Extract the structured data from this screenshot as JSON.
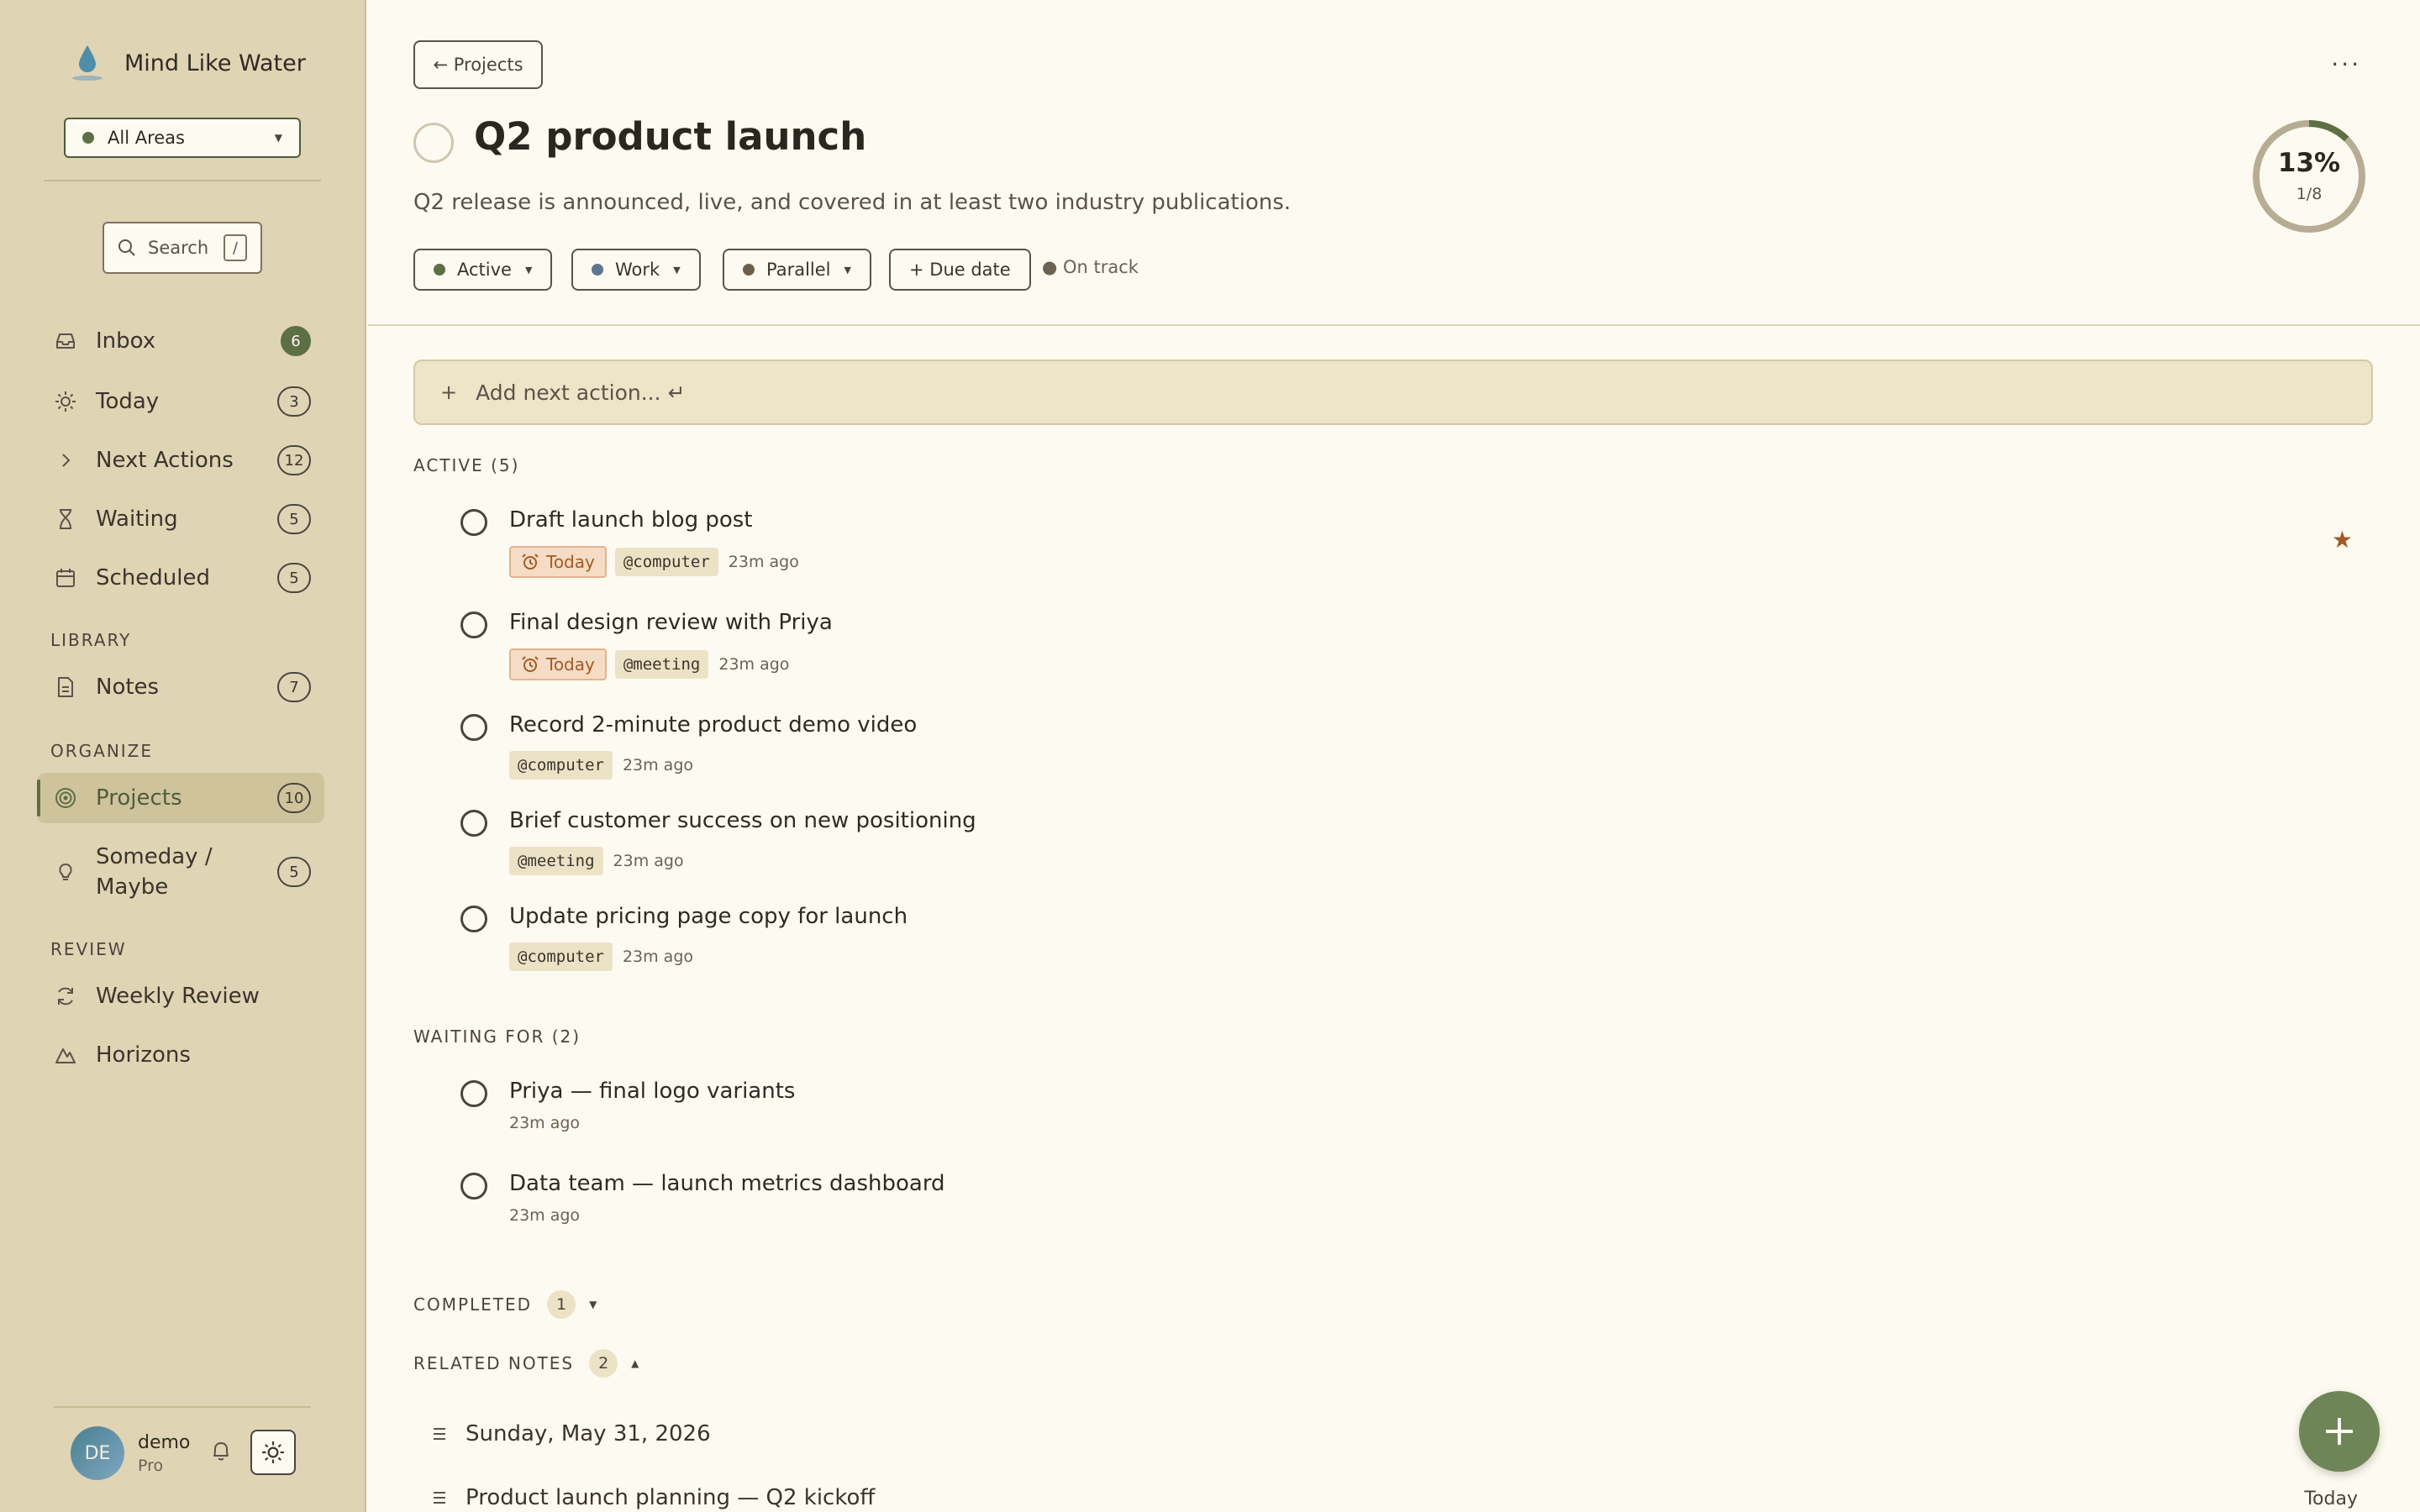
{
  "app": {
    "name": "Mind Like Water"
  },
  "area_selector": {
    "label": "All Areas"
  },
  "search": {
    "label": "Search",
    "shortcut": "/"
  },
  "nav": {
    "inbox": {
      "label": "Inbox",
      "count": "6"
    },
    "today": {
      "label": "Today",
      "count": "3"
    },
    "next_actions": {
      "label": "Next Actions",
      "count": "12"
    },
    "waiting": {
      "label": "Waiting",
      "count": "5"
    },
    "scheduled": {
      "label": "Scheduled",
      "count": "5"
    }
  },
  "library": {
    "label": "LIBRARY",
    "notes": {
      "label": "Notes",
      "count": "7"
    }
  },
  "organize": {
    "label": "ORGANIZE",
    "projects": {
      "label": "Projects",
      "count": "10"
    },
    "someday": {
      "label_line1": "Someday /",
      "label_line2": "Maybe",
      "count": "5"
    }
  },
  "review": {
    "label": "REVIEW",
    "weekly": {
      "label": "Weekly Review"
    },
    "horizons": {
      "label": "Horizons"
    }
  },
  "user": {
    "initials": "DE",
    "name": "demo",
    "plan": "Pro"
  },
  "project": {
    "back_label": "← Projects",
    "more_label": "···",
    "title": "Q2 product launch",
    "description": "Q2 release is announced, live, and covered in at least two industry publications.",
    "status_chip": "Active",
    "area_chip": "Work",
    "mode_chip": "Parallel",
    "due_chip": "+ Due date",
    "health": "● On track",
    "progress": {
      "percent": "13%",
      "fraction": "1/8",
      "value": 0.125
    }
  },
  "colors": {
    "active": "#5d6f45",
    "work": "#5f7594",
    "parallel": "#6b5f4a",
    "accent": "#a15a26"
  },
  "add_action": {
    "placeholder": "Add next action... ↵",
    "plus": "+"
  },
  "active_group": {
    "label": "ACTIVE (5)",
    "tasks": [
      {
        "title": "Draft launch blog post",
        "today": "Today",
        "context": "@computer",
        "ago": "23m ago",
        "starred": true
      },
      {
        "title": "Final design review with Priya",
        "today": "Today",
        "context": "@meeting",
        "ago": "23m ago"
      },
      {
        "title": "Record 2-minute product demo video",
        "context": "@computer",
        "ago": "23m ago"
      },
      {
        "title": "Brief customer success on new positioning",
        "context": "@meeting",
        "ago": "23m ago"
      },
      {
        "title": "Update pricing page copy for launch",
        "context": "@computer",
        "ago": "23m ago"
      }
    ]
  },
  "star_glyph": "★",
  "waiting_group": {
    "label": "WAITING FOR (2)",
    "tasks": [
      {
        "title": "Priya — final logo variants",
        "ago": "23m ago"
      },
      {
        "title": "Data team — launch metrics dashboard",
        "ago": "23m ago"
      }
    ]
  },
  "completed_group": {
    "label": "COMPLETED",
    "count": "1"
  },
  "related_notes": {
    "label": "RELATED NOTES",
    "count": "2",
    "notes": [
      {
        "title": "Sunday, May 31, 2026"
      },
      {
        "title": "Product launch planning — Q2 kickoff"
      }
    ]
  },
  "fab": {
    "label": "Today"
  }
}
